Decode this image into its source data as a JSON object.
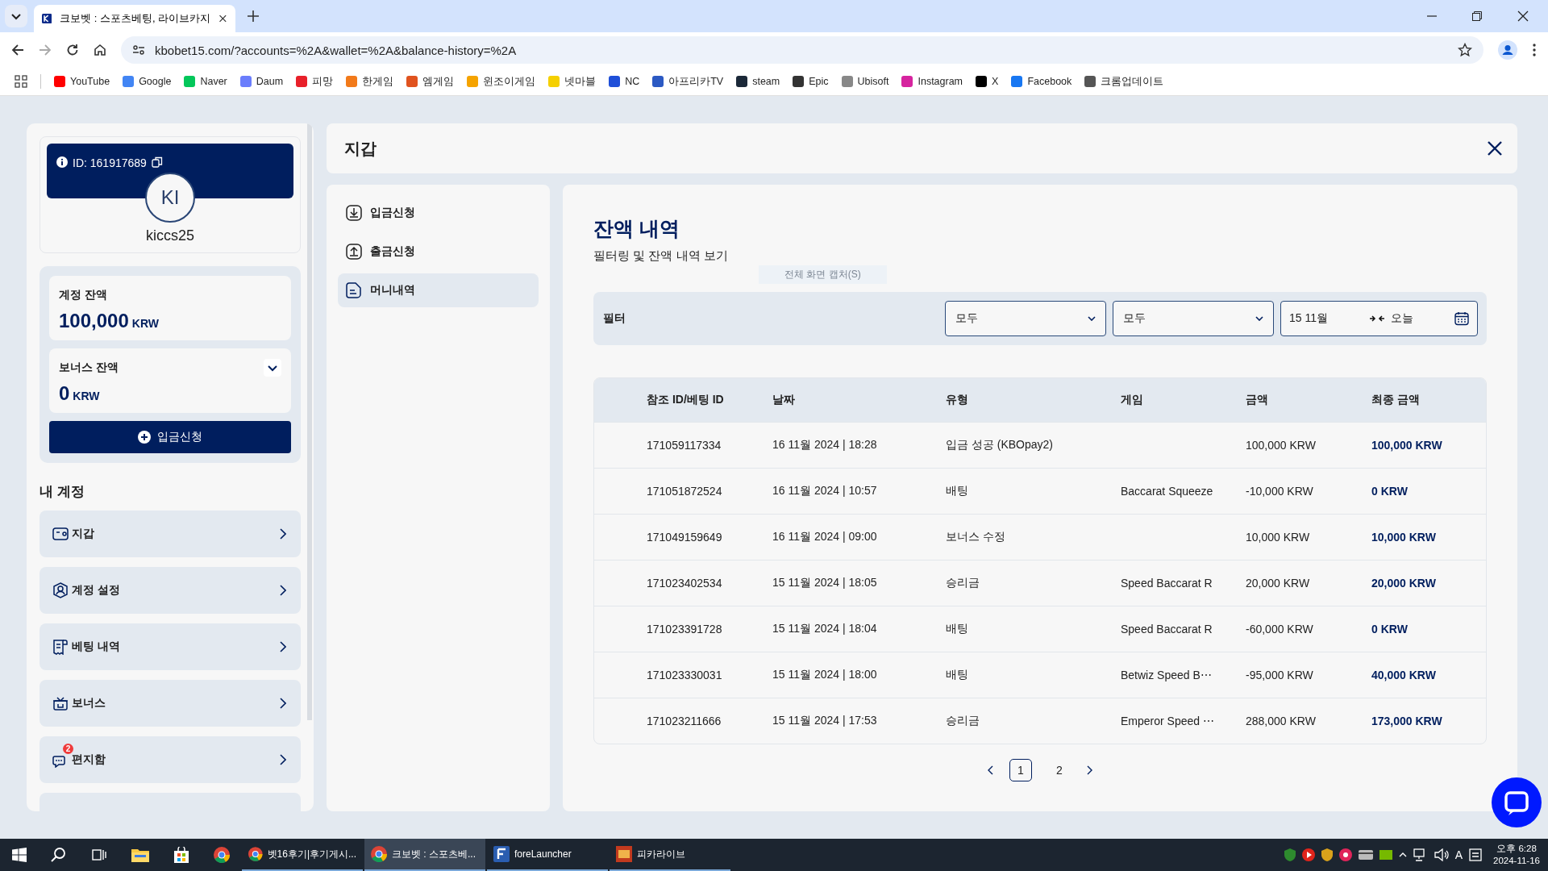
{
  "browser": {
    "tabs": [
      {
        "title": "크보벳 : 스포츠베팅, 라이브카지",
        "selected": true
      }
    ],
    "url": "kbobet15.com/?accounts=%2A&wallet=%2A&balance-history=%2A",
    "bookmarks": [
      {
        "label": "YouTube",
        "color": "#ff0000"
      },
      {
        "label": "Google",
        "color": "#4285f4"
      },
      {
        "label": "Naver",
        "color": "#03c75a"
      },
      {
        "label": "Daum",
        "color": "#6a7dfc"
      },
      {
        "label": "피망",
        "color": "#e8202a"
      },
      {
        "label": "한게임",
        "color": "#f27a1a"
      },
      {
        "label": "엠게임",
        "color": "#e0531f"
      },
      {
        "label": "윈조이게임",
        "color": "#f5a300"
      },
      {
        "label": "넷마블",
        "color": "#f5d000"
      },
      {
        "label": "NC",
        "color": "#1f4fd8"
      },
      {
        "label": "아프리카TV",
        "color": "#2b59c3"
      },
      {
        "label": "steam",
        "color": "#1b2838"
      },
      {
        "label": "Epic",
        "color": "#333333"
      },
      {
        "label": "Ubisoft",
        "color": "#888888"
      },
      {
        "label": "Instagram",
        "color": "#d6249f"
      },
      {
        "label": "X",
        "color": "#000000"
      },
      {
        "label": "Facebook",
        "color": "#1877f2"
      },
      {
        "label": "크롬업데이트",
        "color": "#555555"
      }
    ]
  },
  "sidebar": {
    "user": {
      "id": "ID: 161917689",
      "initials": "KI",
      "username": "kiccs25"
    },
    "balance": {
      "label": "계정 잔액",
      "amount": "100,000",
      "currency": "KRW"
    },
    "bonus": {
      "label": "보너스 잔액",
      "amount": "0",
      "currency": "KRW",
      "expanded": false
    },
    "deposit_button": "입금신청",
    "section_title": "내 계정",
    "menu": [
      {
        "kind": "wallet",
        "label": "지갑"
      },
      {
        "kind": "account",
        "label": "계정 설정"
      },
      {
        "kind": "bets",
        "label": "베팅 내역"
      },
      {
        "kind": "bonus",
        "label": "보너스"
      },
      {
        "kind": "mail",
        "label": "편지함",
        "badge": "2"
      },
      {
        "kind": "partial"
      }
    ]
  },
  "wallet": {
    "title": "지갑",
    "submenu": [
      {
        "kind": "deposit",
        "label": "입금신청",
        "selected": false
      },
      {
        "kind": "withdraw",
        "label": "출금신청",
        "selected": false
      },
      {
        "kind": "history",
        "label": "머니내역",
        "selected": true
      }
    ],
    "heading": "잔액 내역",
    "subtitle": "필터링 및 잔액 내역 보기",
    "tooltip": "전체 화면 캡처(S)",
    "filter": {
      "label": "필터",
      "selects": [
        "모두",
        "모두"
      ],
      "date_from": "15 11월",
      "date_to": "오늘"
    },
    "columns": [
      "참조 ID/베팅 ID",
      "날짜",
      "유형",
      "게임",
      "금액",
      "최종 금액"
    ],
    "rows": [
      [
        "171059117334",
        "16 11월 2024 | 18:28",
        "입금 성공 (KBOpay2)",
        "",
        "100,000 KRW",
        "100,000 KRW"
      ],
      [
        "171051872524",
        "16 11월 2024 | 10:57",
        "배팅",
        "Baccarat Squeeze",
        "-10,000 KRW",
        "0 KRW"
      ],
      [
        "171049159649",
        "16 11월 2024 | 09:00",
        "보너스 수정",
        "",
        "10,000 KRW",
        "10,000 KRW"
      ],
      [
        "171023402534",
        "15 11월 2024 | 18:05",
        "승리금",
        "Speed Baccarat R",
        "20,000 KRW",
        "20,000 KRW"
      ],
      [
        "171023391728",
        "15 11월 2024 | 18:04",
        "배팅",
        "Speed Baccarat R",
        "-60,000 KRW",
        "0 KRW"
      ],
      [
        "171023330031",
        "15 11월 2024 | 18:00",
        "배팅",
        "Betwiz Speed B⋯",
        "-95,000 KRW",
        "40,000 KRW"
      ],
      [
        "171023211666",
        "15 11월 2024 | 17:53",
        "승리금",
        "Emperor Speed ⋯",
        "288,000 KRW",
        "173,000 KRW"
      ]
    ],
    "pages": [
      {
        "label": "1",
        "selected": true
      },
      {
        "label": "2",
        "selected": false
      }
    ]
  },
  "taskbar": {
    "windows": [
      {
        "kind": "chrome",
        "label": "벳16후기|후기게시...",
        "active": false
      },
      {
        "kind": "chrome",
        "label": "크보벳 : 스포츠베...",
        "active": true
      },
      {
        "kind": "launcher",
        "label": "foreLauncher",
        "active": false
      },
      {
        "kind": "pica",
        "label": "피카라이브",
        "active": false
      }
    ],
    "ime": "A",
    "time": "오후 6:28",
    "date": "2024-11-16"
  }
}
